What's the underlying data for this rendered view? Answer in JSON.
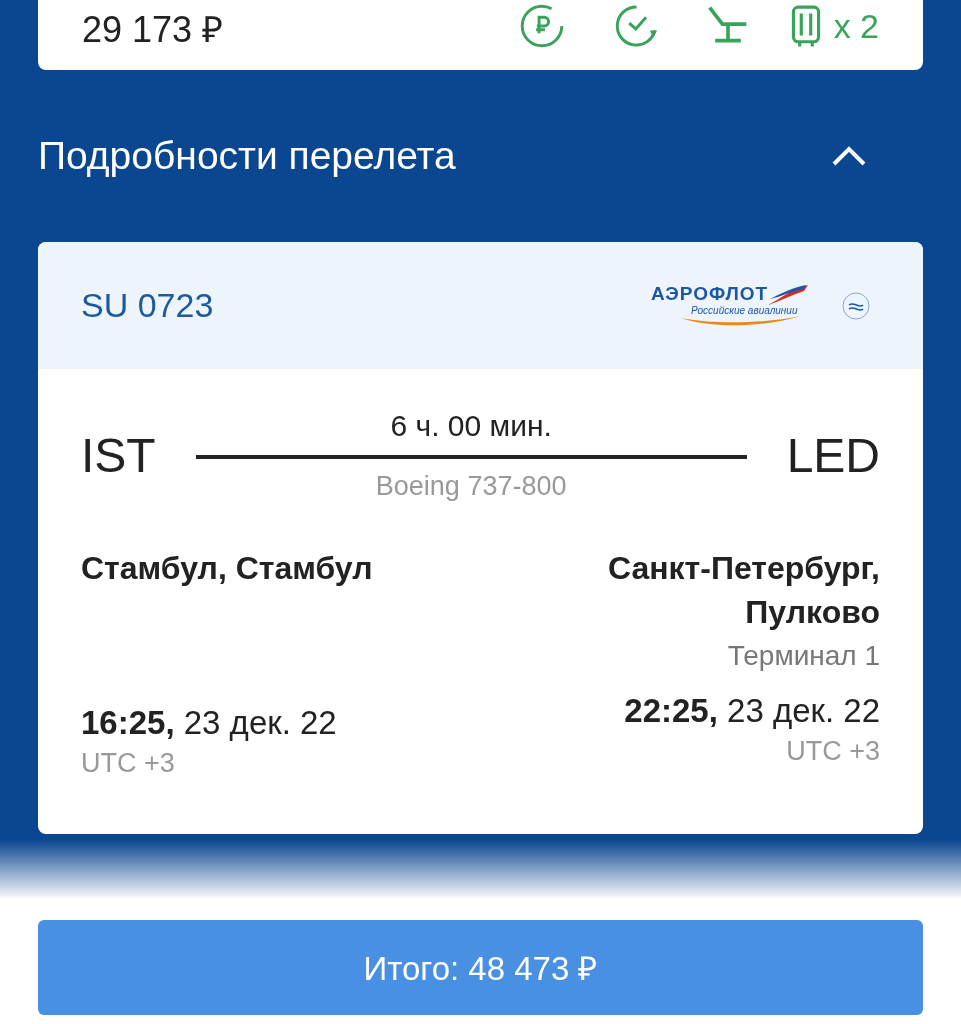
{
  "fare_card": {
    "price": "29 173 ₽",
    "baggage_count": "x 2"
  },
  "section": {
    "title": "Подробности перелета",
    "expanded": true
  },
  "flight": {
    "number": "SU 0723",
    "airline_logo": {
      "name": "АЭРОФЛОТ",
      "tagline": "Российские авиалинии"
    },
    "duration": "6 ч. 00 мин.",
    "aircraft": "Boeing 737-800",
    "departure": {
      "code": "IST",
      "city": "Стамбул, Стамбул",
      "time": "16:25,",
      "date": "23 дек. 22",
      "timezone": "UTC +3"
    },
    "arrival": {
      "code": "LED",
      "city": "Санкт-Петербург, Пулково",
      "terminal": "Терминал 1",
      "time": "22:25,",
      "date": "23 дек. 22",
      "timezone": "UTC +3"
    }
  },
  "total_button": "Итого: 48 473 ₽"
}
